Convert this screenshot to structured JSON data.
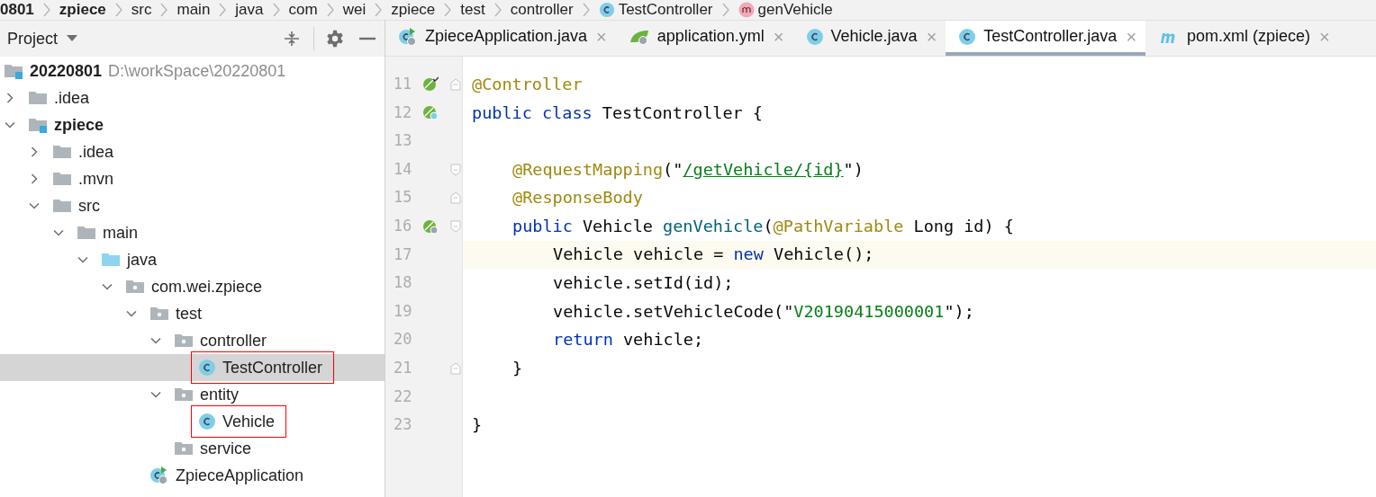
{
  "breadcrumb": [
    {
      "label": "0801",
      "kind": "text",
      "bold": true
    },
    {
      "label": "zpiece",
      "kind": "text",
      "bold": true
    },
    {
      "label": "src",
      "kind": "text",
      "bold": false
    },
    {
      "label": "main",
      "kind": "text",
      "bold": false
    },
    {
      "label": "java",
      "kind": "text",
      "bold": false
    },
    {
      "label": "com",
      "kind": "text",
      "bold": false
    },
    {
      "label": "wei",
      "kind": "text",
      "bold": false
    },
    {
      "label": "zpiece",
      "kind": "text",
      "bold": false
    },
    {
      "label": "test",
      "kind": "text",
      "bold": false
    },
    {
      "label": "controller",
      "kind": "text",
      "bold": false
    },
    {
      "label": "TestController",
      "kind": "class",
      "bold": false
    },
    {
      "label": "genVehicle",
      "kind": "method",
      "bold": false
    }
  ],
  "project_panel": {
    "title": "Project",
    "tree": [
      {
        "label": "20220801",
        "hint": "D:\\workSpace\\20220801",
        "kind": "module",
        "bold": true,
        "selected": false,
        "boxed": false,
        "children": [
          {
            "label": ".idea",
            "kind": "folder",
            "expanded": false,
            "bold": false,
            "selected": false,
            "boxed": false
          },
          {
            "label": "zpiece",
            "kind": "module",
            "expanded": true,
            "bold": true,
            "selected": false,
            "boxed": false,
            "children": [
              {
                "label": ".idea",
                "kind": "folder",
                "expanded": false,
                "bold": false,
                "selected": false,
                "boxed": false
              },
              {
                "label": ".mvn",
                "kind": "folder",
                "expanded": false,
                "bold": false,
                "selected": false,
                "boxed": false
              },
              {
                "label": "src",
                "kind": "folder",
                "expanded": true,
                "bold": false,
                "selected": false,
                "boxed": false,
                "children": [
                  {
                    "label": "main",
                    "kind": "folder",
                    "expanded": true,
                    "bold": false,
                    "selected": false,
                    "boxed": false,
                    "children": [
                      {
                        "label": "java",
                        "kind": "source",
                        "expanded": true,
                        "bold": false,
                        "selected": false,
                        "boxed": false,
                        "children": [
                          {
                            "label": "com.wei.zpiece",
                            "kind": "package",
                            "expanded": true,
                            "bold": false,
                            "selected": false,
                            "boxed": false,
                            "children": [
                              {
                                "label": "test",
                                "kind": "package",
                                "expanded": true,
                                "bold": false,
                                "selected": false,
                                "boxed": false,
                                "children": [
                                  {
                                    "label": "controller",
                                    "kind": "package",
                                    "expanded": true,
                                    "bold": false,
                                    "selected": false,
                                    "boxed": false,
                                    "children": [
                                      {
                                        "label": "TestController",
                                        "kind": "class",
                                        "bold": false,
                                        "selected": true,
                                        "boxed": true
                                      }
                                    ]
                                  },
                                  {
                                    "label": "entity",
                                    "kind": "package",
                                    "expanded": true,
                                    "bold": false,
                                    "selected": false,
                                    "boxed": false,
                                    "children": [
                                      {
                                        "label": "Vehicle",
                                        "kind": "class",
                                        "bold": false,
                                        "selected": false,
                                        "boxed": true
                                      }
                                    ]
                                  },
                                  {
                                    "label": "service",
                                    "kind": "package",
                                    "bold": false,
                                    "selected": false,
                                    "boxed": false
                                  }
                                ]
                              },
                              {
                                "label": "ZpieceApplication",
                                "kind": "app",
                                "bold": false,
                                "selected": false,
                                "boxed": false
                              }
                            ]
                          }
                        ]
                      }
                    ]
                  }
                ]
              }
            ]
          }
        ]
      }
    ]
  },
  "tabs": [
    {
      "label": "ZpieceApplication.java",
      "kind": "app",
      "selected": false,
      "close": "×"
    },
    {
      "label": "application.yml",
      "kind": "yml",
      "selected": false,
      "close": "×"
    },
    {
      "label": "Vehicle.java",
      "kind": "class",
      "selected": false,
      "close": "×"
    },
    {
      "label": "TestController.java",
      "kind": "class",
      "selected": true,
      "close": "×"
    },
    {
      "label": "pom.xml (zpiece)",
      "kind": "maven",
      "selected": false,
      "close": "×"
    }
  ],
  "editor": {
    "lines": [
      {
        "number": "11",
        "current": false,
        "gutter": {
          "kind": "bean"
        },
        "fold": {
          "kind": "end"
        },
        "tokens": [
          {
            "t": "@Controller",
            "kind": "annotation"
          }
        ]
      },
      {
        "number": "12",
        "current": false,
        "gutter": {
          "kind": "bean-class"
        },
        "tokens": [
          {
            "t": "public class",
            "kind": "keyword"
          },
          {
            "t": " TestController {",
            "kind": "plain"
          }
        ],
        "children": [
          {
            "number": "13",
            "current": false
          },
          {
            "number": "14",
            "current": false,
            "fold": {
              "kind": "start"
            },
            "tokens": [
              {
                "t": "@RequestMapping",
                "kind": "annotation"
              },
              {
                "t": "(\"",
                "kind": "plain"
              },
              {
                "t": "/getVehicle/{id}",
                "kind": "link"
              },
              {
                "t": "\")",
                "kind": "plain"
              }
            ]
          },
          {
            "number": "15",
            "current": false,
            "fold": {
              "kind": "end"
            },
            "tokens": [
              {
                "t": "@ResponseBody",
                "kind": "annotation"
              }
            ]
          },
          {
            "number": "16",
            "current": false,
            "gutter": {
              "kind": "bean-web"
            },
            "fold": {
              "kind": "start"
            },
            "tokens": [
              {
                "t": "public",
                "kind": "keyword"
              },
              {
                "t": " Vehicle ",
                "kind": "plain"
              },
              {
                "t": "genVehicle",
                "kind": "method"
              },
              {
                "t": "(",
                "kind": "plain"
              },
              {
                "t": "@PathVariable",
                "kind": "annotation"
              },
              {
                "t": " Long id) {",
                "kind": "plain"
              }
            ],
            "children": [
              {
                "number": "17",
                "current": true,
                "tokens": [
                  {
                    "t": "Vehicle vehicle = ",
                    "kind": "plain"
                  },
                  {
                    "t": "new",
                    "kind": "keyword"
                  },
                  {
                    "t": " Vehicle();",
                    "kind": "plain"
                  }
                ]
              },
              {
                "number": "18",
                "current": false,
                "tokens": [
                  {
                    "t": "vehicle.setId(id);",
                    "kind": "plain"
                  }
                ]
              },
              {
                "number": "19",
                "current": false,
                "tokens": [
                  {
                    "t": "vehicle.setVehicleCode(\"",
                    "kind": "plain"
                  },
                  {
                    "t": "V20190415000001",
                    "kind": "string"
                  },
                  {
                    "t": "\");",
                    "kind": "plain"
                  }
                ]
              },
              {
                "number": "20",
                "current": false,
                "tokens": [
                  {
                    "t": "return",
                    "kind": "keyword"
                  },
                  {
                    "t": " vehicle;",
                    "kind": "plain"
                  }
                ]
              }
            ]
          },
          {
            "number": "21",
            "current": false,
            "fold": {
              "kind": "end"
            },
            "tokens": [
              {
                "t": "}",
                "kind": "plain"
              }
            ]
          },
          {
            "number": "22",
            "current": false
          }
        ]
      },
      {
        "number": "23",
        "current": false,
        "tokens": [
          {
            "t": "}",
            "kind": "plain"
          }
        ]
      }
    ]
  }
}
